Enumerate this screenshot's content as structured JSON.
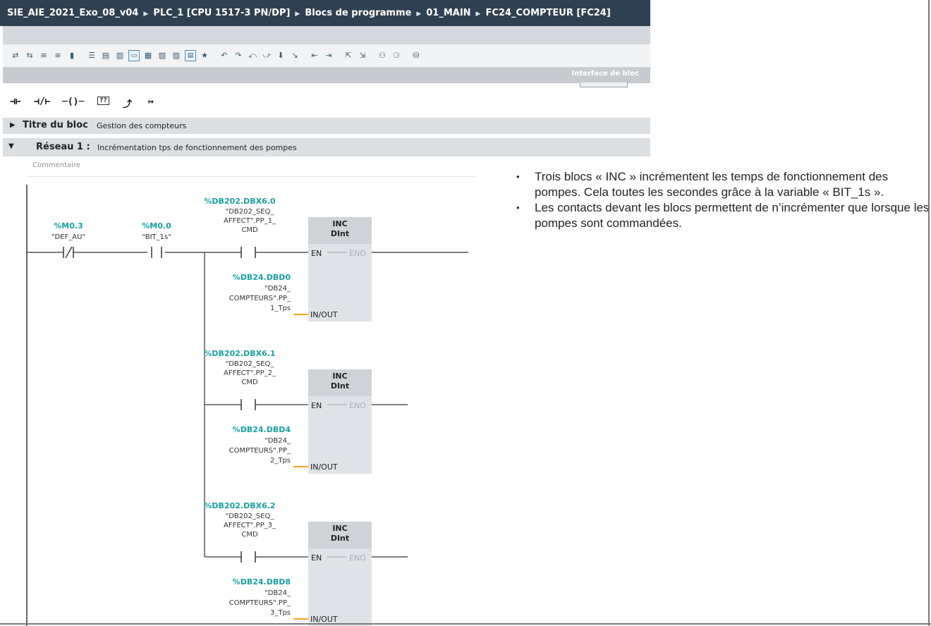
{
  "breadcrumb": {
    "project": "SIE_AIE_2021_Exo_08_v04",
    "plc": "PLC_1 [CPU 1517-3 PN/DP]",
    "folder": "Blocs de programme",
    "group": "01_MAIN",
    "block": "FC24_COMPTEUR [FC24]",
    "separator": "▶"
  },
  "panel_label": "Interface de bloc",
  "block_title": {
    "label": "Titre du bloc",
    "value": "Gestion des compteurs"
  },
  "network": {
    "label": "Réseau 1 :",
    "title": "Incrémentation tps de fonctionnement des pompes",
    "comment_placeholder": "Commentaire"
  },
  "icons": {
    "toolbar": [
      "icon-a",
      "icon-b",
      "icon-c",
      "icon-d",
      "icon-e",
      "lines-icon",
      "box-icon",
      "box2-icon",
      "comment-icon",
      "insert-icon",
      "insert2-icon",
      "insert3-icon",
      "list-icon",
      "favorite-icon",
      "goto-icon",
      "goto2-icon",
      "goto3-icon",
      "goto4-icon",
      "download-icon",
      "arrow-icon",
      "align-icon",
      "align2-icon",
      "nav-icon",
      "nav2-icon",
      "monitor-icon",
      "monitor2-icon",
      "db-icon"
    ],
    "ladder": [
      "no-contact-icon",
      "nc-contact-icon",
      "coil-icon",
      "empty-box-icon",
      "open-branch-icon",
      "close-branch-icon"
    ]
  },
  "ladder": {
    "contact1": {
      "address": "%M0.3",
      "name": "\"DEF_AU\""
    },
    "contact2": {
      "address": "%M0.0",
      "name": "\"BIT_1s\""
    },
    "blocks": [
      {
        "cmd_address": "%DB202.DBX6.0",
        "cmd_lines": [
          "\"DB202_SEQ_",
          "AFFECT\".PP_1_",
          "CMD"
        ],
        "title": "INC",
        "type": "DInt",
        "en": "EN",
        "eno": "ENO",
        "inout": "IN/OUT",
        "var_address": "%DB24.DBD0",
        "var_lines": [
          "\"DB24_",
          "COMPTEURS\".PP_",
          "1_Tps"
        ]
      },
      {
        "cmd_address": "%DB202.DBX6.1",
        "cmd_lines": [
          "\"DB202_SEQ_",
          "AFFECT\".PP_2_",
          "CMD"
        ],
        "title": "INC",
        "type": "DInt",
        "en": "EN",
        "eno": "ENO",
        "inout": "IN/OUT",
        "var_address": "%DB24.DBD4",
        "var_lines": [
          "\"DB24_",
          "COMPTEURS\".PP_",
          "2_Tps"
        ]
      },
      {
        "cmd_address": "%DB202.DBX6.2",
        "cmd_lines": [
          "\"DB202_SEQ_",
          "AFFECT\".PP_3_",
          "CMD"
        ],
        "title": "INC",
        "type": "DInt",
        "en": "EN",
        "eno": "ENO",
        "inout": "IN/OUT",
        "var_address": "%DB24.DBD8",
        "var_lines": [
          "\"DB24_",
          "COMPTEURS\".PP_",
          "3_Tps"
        ]
      }
    ]
  },
  "notes": [
    "Trois blocs « INC » incrémentent les temps de fonctionnement des pompes. Cela toutes les secondes grâce à la variable « BIT_1s ».",
    "Les contacts devant les blocs permettent de n’incrémenter que lorsque les pompes sont commandées."
  ],
  "colors": {
    "title_bg": "#2f4150",
    "address": "#1a9fa3",
    "block_bg": "#dfe2e6",
    "inout_wire": "#f5a623"
  }
}
